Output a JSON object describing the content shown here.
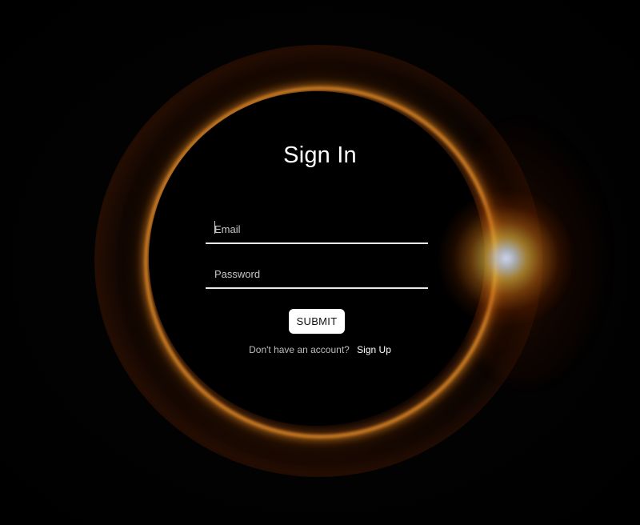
{
  "form": {
    "title": "Sign In",
    "email": {
      "value": "",
      "placeholder": "Email"
    },
    "password": {
      "value": "",
      "placeholder": "Password"
    },
    "submit_label": "SUBMIT",
    "signup_prompt": "Don't have an account?",
    "signup_link": "Sign Up"
  },
  "background": {
    "image": "solar-eclipse-diamond-ring",
    "colors": {
      "base": "#000000",
      "ring": "#e68c28",
      "flare": "#d7e1ff"
    }
  }
}
